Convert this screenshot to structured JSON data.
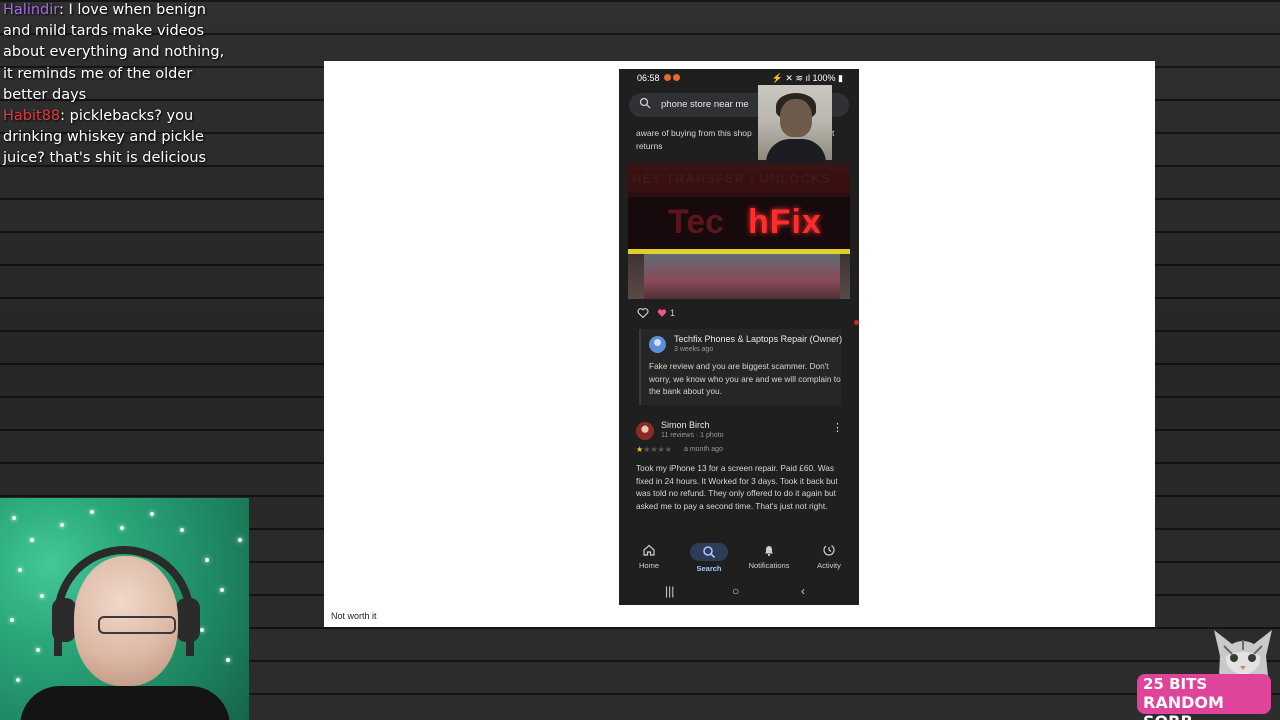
{
  "chat": [
    {
      "user": "Halindir",
      "text": ": I love when benign and mild tards make videos about everything and nothing, it reminds me of the older better days"
    },
    {
      "user": "Habit88",
      "text": ": picklebacks? you drinking whiskey and pickle juice? that's shit is delicious"
    }
  ],
  "slide": {
    "caption": "Not worth it"
  },
  "phone": {
    "status": {
      "time": "06:58",
      "battery": "100%"
    },
    "search": {
      "query": "phone store near me"
    },
    "snippet": {
      "line1": "aware of buying from this shop",
      "line1_right": "t",
      "line2": "returns"
    },
    "photo": {
      "banner": "NEY TRANSFER • UNLOCKS",
      "sign": "hFix",
      "sign_dim": "Tec"
    },
    "likes": {
      "count": "1"
    },
    "owner_reply": {
      "name": "Techfix Phones & Laptops Repair (Owner)",
      "time": "3 weeks ago",
      "text": "Fake review and you are biggest scammer. Don't worry, we know who you are and we will complain to the bank about you."
    },
    "review": {
      "name": "Simon Birch",
      "meta": "11 reviews · 1 photo",
      "rating": 1,
      "ago": "a month ago",
      "text": "Took my iPhone 13 for a screen repair. Paid £60. Was fixed in 24 hours. It Worked for 3 days. Took it back but was told no refund. They only offered to do it again but asked me to pay a second time. That's just not right."
    },
    "nav": {
      "home": "Home",
      "search": "Search",
      "notifications": "Notifications",
      "activity": "Activity"
    },
    "sysnav": {
      "recents": "|||",
      "home": "○",
      "back": "‹"
    }
  },
  "bits": {
    "line1": "25 BITS",
    "line2": "RANDOM SORB"
  },
  "colors": {
    "accent_pink": "#e0439a",
    "user1": "#a46ae0",
    "user2": "#e2383f",
    "star": "#f5c22f"
  }
}
